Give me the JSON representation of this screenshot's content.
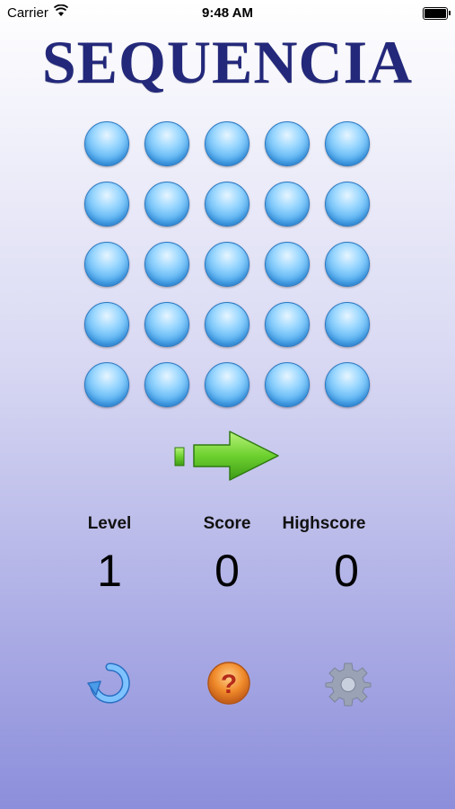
{
  "status_bar": {
    "carrier": "Carrier",
    "time": "9:48 AM"
  },
  "app": {
    "title": "SEQUENCIA"
  },
  "grid": {
    "rows": 5,
    "cols": 5,
    "dot_color": "#5ab6f3"
  },
  "stats": {
    "level_label": "Level",
    "score_label": "Score",
    "highscore_label": "Highscore",
    "level": "1",
    "score": "0",
    "highscore": "0"
  },
  "controls": {
    "next_icon": "green-arrow-right-icon",
    "restart_icon": "restart-icon",
    "help_icon": "help-question-icon",
    "help_mark": "?",
    "settings_icon": "gear-icon"
  },
  "colors": {
    "title": "#23287a",
    "arrow": "#5cc22a",
    "help": "#f08a2a",
    "gear": "#9aa3b6",
    "restart": "#4a9be8"
  }
}
